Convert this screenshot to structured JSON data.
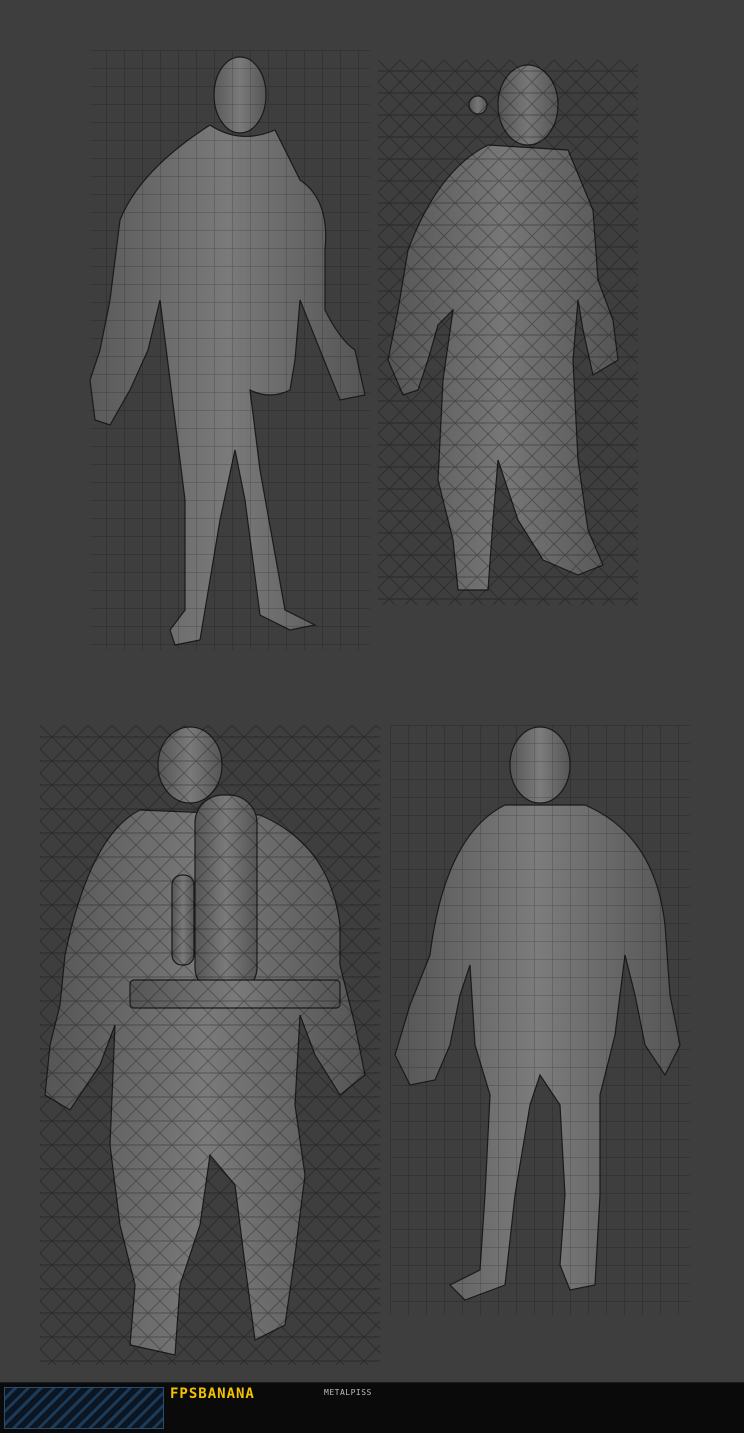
{
  "footer": {
    "brand": "FPSBANANA",
    "author": "METALPISS"
  },
  "colors": {
    "background": "#3e3e3e",
    "model_fill": "#6e6e6e",
    "wire": "#1c1c1c",
    "footer_bg": "#0a0a0a",
    "brand_yellow": "#f2c200"
  },
  "models": [
    {
      "view": "front-body-mesh",
      "pose": "front"
    },
    {
      "view": "front-outfit-mesh",
      "pose": "front"
    },
    {
      "view": "back-outfit-mesh",
      "pose": "back"
    },
    {
      "view": "back-body-mesh",
      "pose": "back"
    }
  ]
}
